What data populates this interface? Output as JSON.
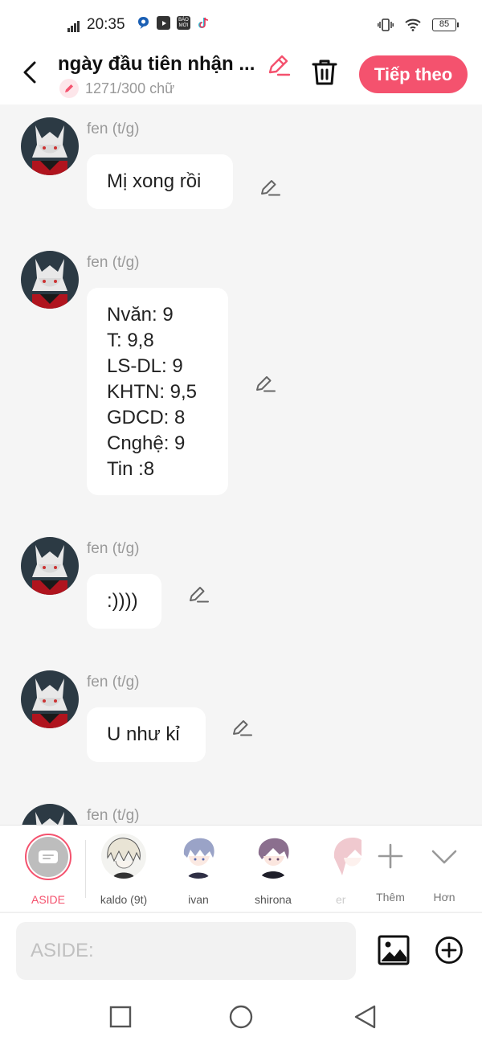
{
  "status_bar": {
    "time": "20:35",
    "battery": "85",
    "apps": [
      {
        "icon": "chat-app-icon",
        "label": "",
        "color": "#1a5fb4"
      },
      {
        "icon": "youtube-icon",
        "label": "",
        "color": "#333333"
      },
      {
        "icon": "bao-moi-icon",
        "label": "BÁO MỚI",
        "color": "#333333"
      },
      {
        "icon": "tiktok-icon",
        "label": "",
        "color": "#ffffff"
      }
    ]
  },
  "header": {
    "title": "ngày đầu tiên nhận ...",
    "word_count": "1271/300 chữ",
    "next_label": "Tiếp theo",
    "accent": "#f4526e"
  },
  "messages": [
    {
      "sender": "fen (t/g)",
      "lines": [
        "Mị xong rồi"
      ]
    },
    {
      "sender": "fen (t/g)",
      "lines": [
        "Nvăn: 9",
        "T: 9,8",
        "LS-DL: 9",
        "KHTN: 9,5",
        "GDCD: 8",
        "Cnghệ: 9",
        "Tin :8"
      ]
    },
    {
      "sender": "fen (t/g)",
      "lines": [
        ":))))"
      ]
    },
    {
      "sender": "fen (t/g)",
      "lines": [
        "U như kỉ"
      ]
    },
    {
      "sender": "fen (t/g)",
      "lines": []
    }
  ],
  "characters": [
    {
      "name": "ASIDE",
      "selected": true
    },
    {
      "name": "kaldo (9t)"
    },
    {
      "name": "ivan"
    },
    {
      "name": "shirona"
    },
    {
      "name": "er"
    }
  ],
  "actions": {
    "more_label": "Thêm",
    "expand_label": "Hơn"
  },
  "input": {
    "placeholder": "ASIDE:"
  }
}
